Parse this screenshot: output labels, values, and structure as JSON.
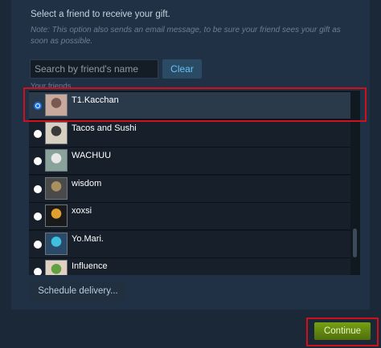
{
  "prompt": "Select a friend to receive your gift.",
  "note": "Note: This option also sends an email message, to be sure your friend sees your gift as soon as possible.",
  "search": {
    "placeholder": "Search by friend's name",
    "clear_label": "Clear"
  },
  "list_label": "Your friends",
  "friends": [
    {
      "name": "T1.Kacchan",
      "selected": true,
      "avatar_colors": [
        "#c9a99c",
        "#7a5a50"
      ]
    },
    {
      "name": "Tacos and Sushi",
      "selected": false,
      "avatar_colors": [
        "#d8d0c0",
        "#3a3a3a"
      ]
    },
    {
      "name": "WACHUU",
      "selected": false,
      "avatar_colors": [
        "#8aa39a",
        "#e8e8e8"
      ]
    },
    {
      "name": "wisdom",
      "selected": false,
      "avatar_colors": [
        "#4a4a4a",
        "#a89060"
      ]
    },
    {
      "name": "xoxsi",
      "selected": false,
      "avatar_colors": [
        "#1a1a1a",
        "#e0a030"
      ]
    },
    {
      "name": "Yo.Mari.",
      "selected": false,
      "avatar_colors": [
        "#2a4a6a",
        "#40c0e0"
      ]
    },
    {
      "name": "Influence",
      "selected": false,
      "avatar_colors": [
        "#e0d0c0",
        "#60a040"
      ]
    }
  ],
  "schedule_label": "Schedule delivery...",
  "continue_label": "Continue",
  "colors": {
    "background": "#1b2838",
    "accent_green": "#76a013",
    "highlight_red": "#d0101a",
    "link_blue": "#67c1f5"
  }
}
